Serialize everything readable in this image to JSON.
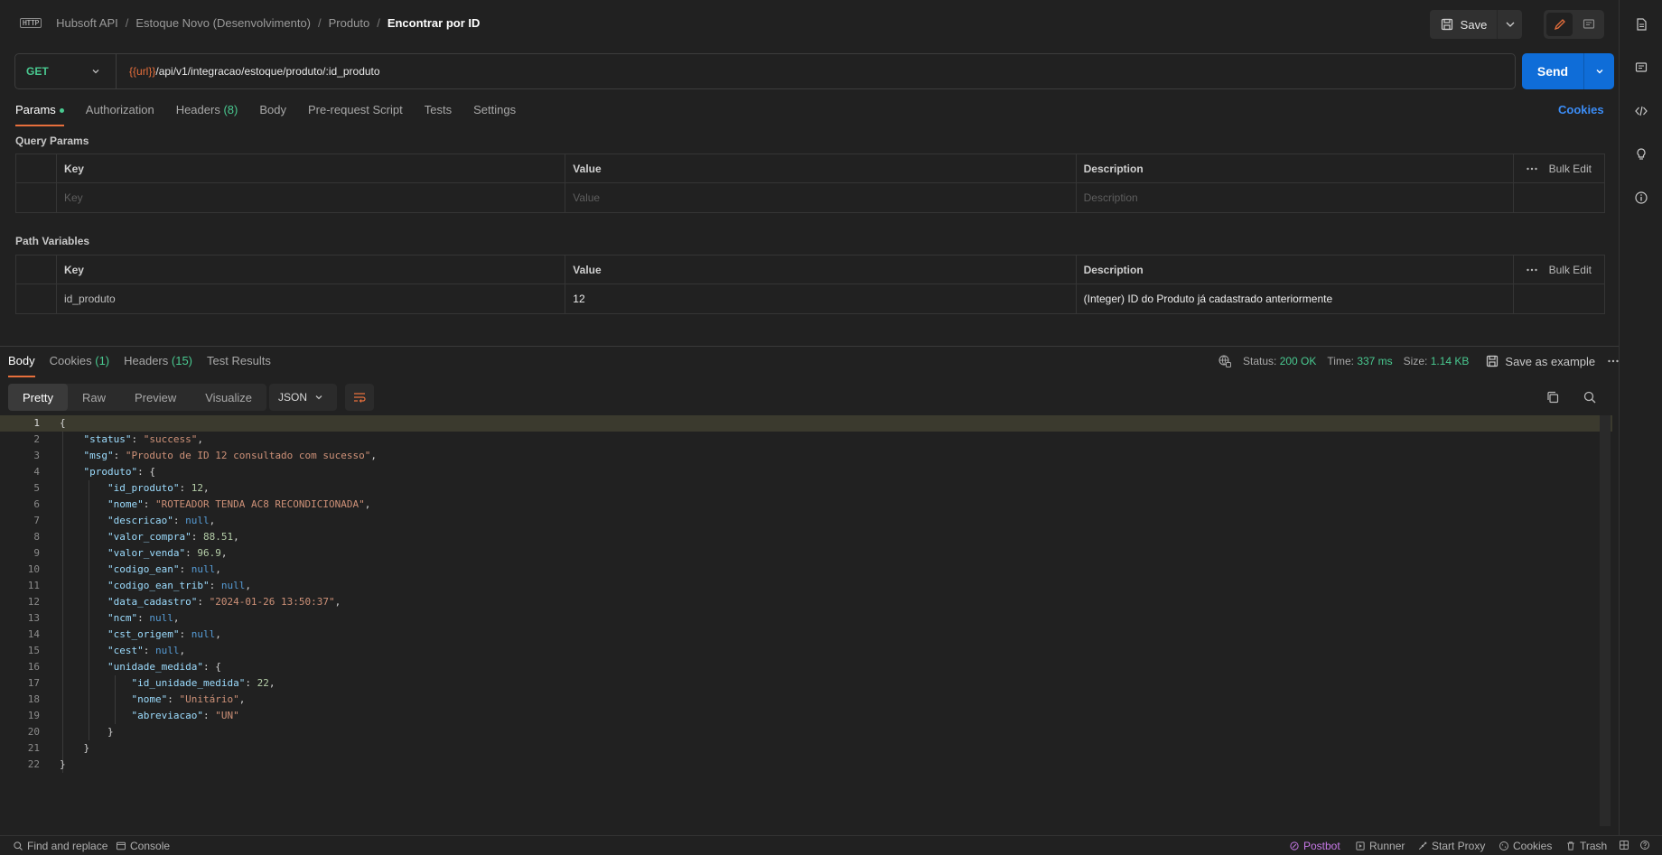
{
  "header": {
    "breadcrumb": [
      "Hubsoft API",
      "Estoque Novo (Desenvolvimento)",
      "Produto"
    ],
    "current": "Encontrar por ID",
    "separator": "/",
    "http_badge": "HTTP",
    "save_label": "Save"
  },
  "request": {
    "method": "GET",
    "url_variable": "{{url}}",
    "url_path": "/api/v1/integracao/estoque/produto/:id_produto",
    "send_label": "Send"
  },
  "request_tabs": {
    "params": "Params",
    "authorization": "Authorization",
    "headers": "Headers",
    "headers_count": "(8)",
    "body": "Body",
    "pre_request": "Pre-request Script",
    "tests": "Tests",
    "settings": "Settings",
    "cookies": "Cookies"
  },
  "query_params": {
    "title": "Query Params",
    "headers": {
      "key": "Key",
      "value": "Value",
      "description": "Description",
      "bulk": "Bulk Edit"
    },
    "placeholders": {
      "key": "Key",
      "value": "Value",
      "description": "Description"
    }
  },
  "path_variables": {
    "title": "Path Variables",
    "headers": {
      "key": "Key",
      "value": "Value",
      "description": "Description",
      "bulk": "Bulk Edit"
    },
    "row": {
      "key": "id_produto",
      "value": "12",
      "description": "(Integer) ID do Produto já cadastrado anteriormente"
    }
  },
  "response_tabs": {
    "body": "Body",
    "cookies": "Cookies",
    "cookies_count": "(1)",
    "headers": "Headers",
    "headers_count": "(15)",
    "test_results": "Test Results"
  },
  "status": {
    "status_label": "Status:",
    "status_value": "200 OK",
    "time_label": "Time:",
    "time_value": "337 ms",
    "size_label": "Size:",
    "size_value": "1.14 KB",
    "save_example": "Save as example"
  },
  "format_tabs": {
    "pretty": "Pretty",
    "raw": "Raw",
    "preview": "Preview",
    "visualize": "Visualize",
    "lang": "JSON"
  },
  "code": {
    "line_numbers": [
      "1",
      "2",
      "3",
      "4",
      "5",
      "6",
      "7",
      "8",
      "9",
      "10",
      "11",
      "12",
      "13",
      "14",
      "15",
      "16",
      "17",
      "18",
      "19",
      "20",
      "21",
      "22"
    ],
    "l1": "{",
    "l2k": "\"status\"",
    "l2v": "\"success\"",
    "l3k": "\"msg\"",
    "l3v": "\"Produto de ID 12 consultado com sucesso\"",
    "l4k": "\"produto\"",
    "l5k": "\"id_produto\"",
    "l5v": "12",
    "l6k": "\"nome\"",
    "l6v": "\"ROTEADOR TENDA AC8 RECONDICIONADA\"",
    "l7k": "\"descricao\"",
    "l7v": "null",
    "l8k": "\"valor_compra\"",
    "l8v": "88.51",
    "l9k": "\"valor_venda\"",
    "l9v": "96.9",
    "l10k": "\"codigo_ean\"",
    "l10v": "null",
    "l11k": "\"codigo_ean_trib\"",
    "l11v": "null",
    "l12k": "\"data_cadastro\"",
    "l12v": "\"2024-01-26 13:50:37\"",
    "l13k": "\"ncm\"",
    "l13v": "null",
    "l14k": "\"cst_origem\"",
    "l14v": "null",
    "l15k": "\"cest\"",
    "l15v": "null",
    "l16k": "\"unidade_medida\"",
    "l17k": "\"id_unidade_medida\"",
    "l17v": "22",
    "l18k": "\"nome\"",
    "l18v": "\"Unitário\"",
    "l19k": "\"abreviacao\"",
    "l19v": "\"UN\""
  },
  "footer": {
    "find_replace": "Find and replace",
    "console": "Console",
    "postbot": "Postbot",
    "runner": "Runner",
    "start_proxy": "Start Proxy",
    "cookies": "Cookies",
    "trash": "Trash"
  },
  "colors": {
    "accent": "#e76f3c",
    "send": "#0f6dd8",
    "method_get": "#49c990",
    "status_ok": "#49c990",
    "link": "#3b8cf5"
  }
}
